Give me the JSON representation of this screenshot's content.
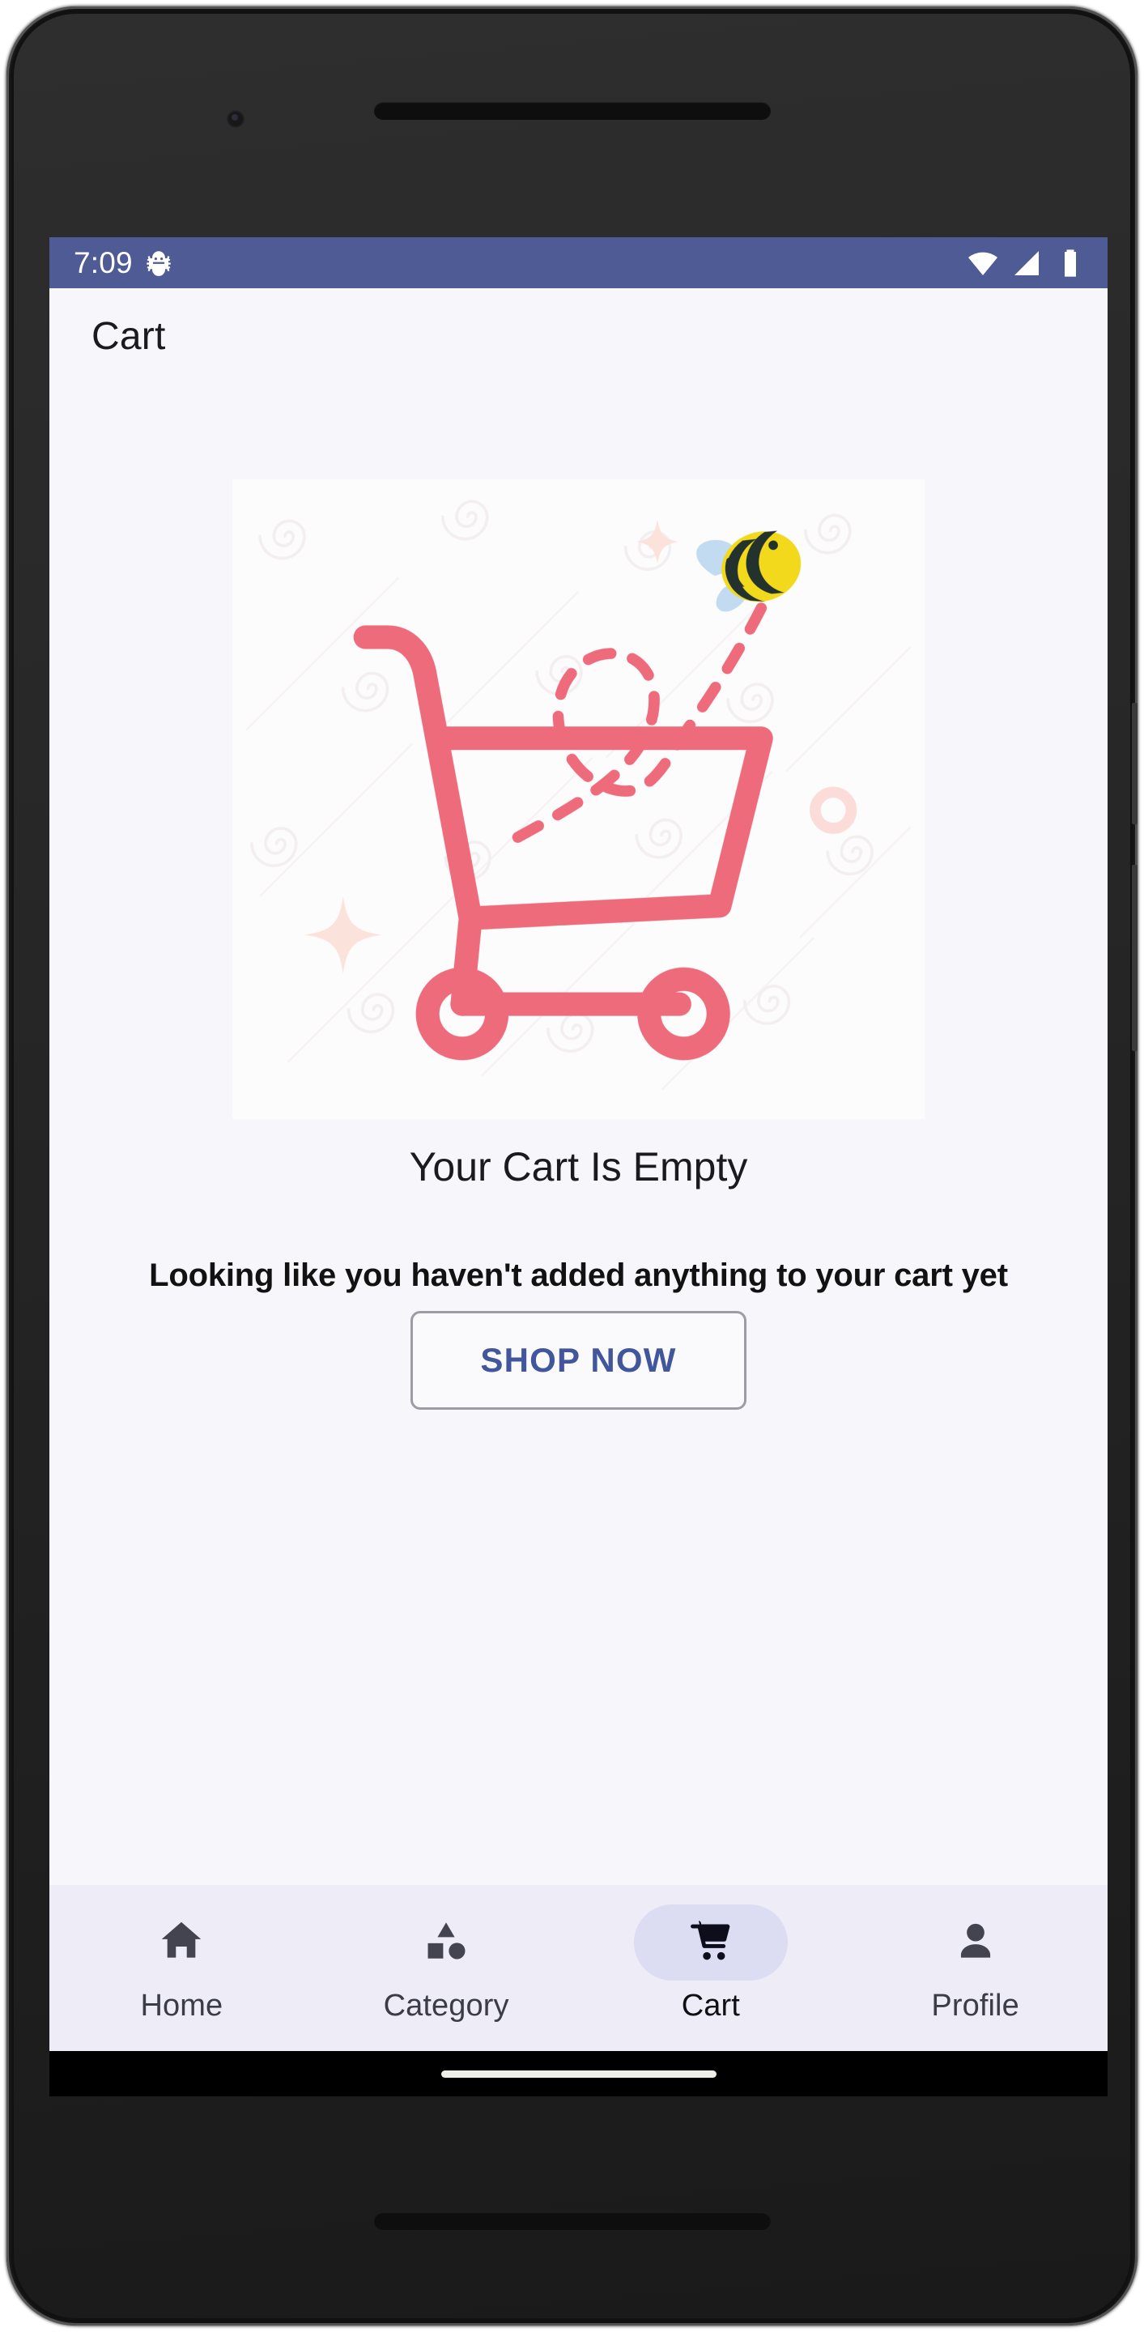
{
  "status_bar": {
    "time": "7:09",
    "left_icons": [
      "bug-icon"
    ],
    "right_icons": [
      "wifi-icon",
      "signal-icon",
      "battery-icon"
    ],
    "background_color": "#4f5b95",
    "foreground_color": "#ffffff"
  },
  "app_bar": {
    "title": "Cart"
  },
  "empty_state": {
    "illustration_name": "empty-cart-illustration",
    "illustration": {
      "cart_color": "#ee6b7c",
      "bee_body_color": "#f2d91c",
      "bee_stripe_color": "#24322d",
      "bee_wing_color": "#c3dbf0",
      "sparkle_color": "#fbe3dc",
      "ring_color": "#fbdcd8",
      "background_color": "#fdfcfd"
    },
    "title": "Your Cart Is Empty",
    "subtitle": "Looking like you haven't added anything to your cart yet",
    "cta_label": "SHOP NOW",
    "cta_text_color": "#41569b",
    "cta_border_color": "#9c9ca6"
  },
  "bottom_nav": {
    "background_color": "#eeecf6",
    "active_pill_color": "#dcdcf2",
    "items": [
      {
        "label": "Home",
        "icon": "home-icon",
        "active": false
      },
      {
        "label": "Category",
        "icon": "category-shapes-icon",
        "active": false
      },
      {
        "label": "Cart",
        "icon": "shopping-cart-icon",
        "active": true
      },
      {
        "label": "Profile",
        "icon": "person-icon",
        "active": false
      }
    ]
  }
}
